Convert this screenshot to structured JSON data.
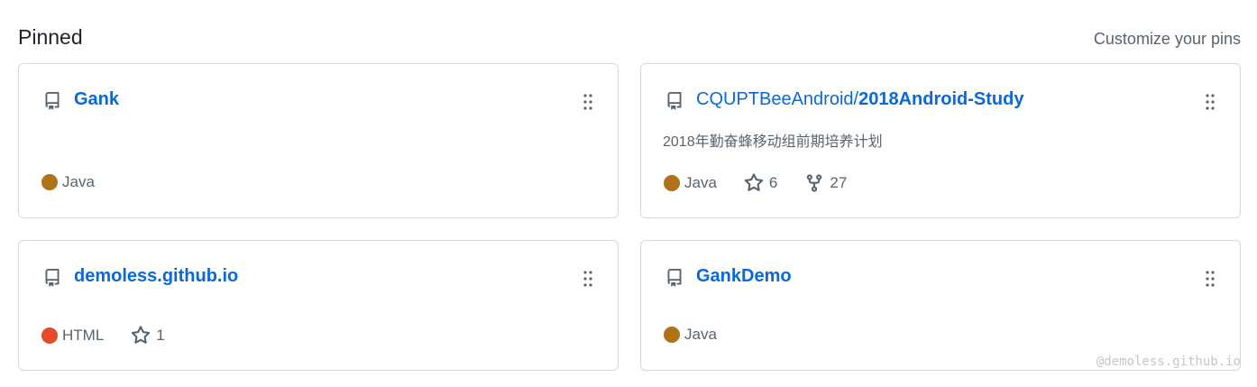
{
  "header": {
    "title": "Pinned",
    "customize_label": "Customize your pins"
  },
  "cards": [
    {
      "owner": "",
      "name": "Gank",
      "description": "",
      "language": "Java",
      "language_color": "#b07219",
      "stars": "",
      "forks": ""
    },
    {
      "owner": "CQUPTBeeAndroid/",
      "name": "2018Android-Study",
      "description": "2018年勤奋蜂移动组前期培养计划",
      "language": "Java",
      "language_color": "#b07219",
      "stars": "6",
      "forks": "27"
    },
    {
      "owner": "",
      "name": "demoless.github.io",
      "description": "",
      "language": "HTML",
      "language_color": "#e34c26",
      "stars": "1",
      "forks": ""
    },
    {
      "owner": "",
      "name": "GankDemo",
      "description": "",
      "language": "Java",
      "language_color": "#b07219",
      "stars": "",
      "forks": ""
    }
  ],
  "icons": {
    "repo": "repo-icon",
    "grabber": "grabber-icon",
    "star": "star-icon",
    "fork": "fork-icon"
  },
  "watermark": "@demoless.github.io"
}
